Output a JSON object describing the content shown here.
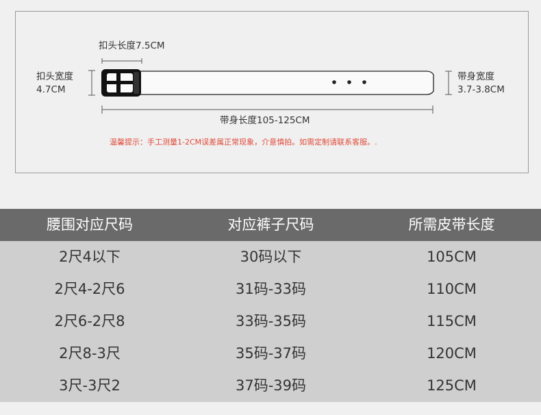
{
  "diagram": {
    "buckle_length_label": "扣头长度7.5CM",
    "buckle_width_title": "扣头宽度",
    "buckle_width_value": "4.7CM",
    "strap_width_title": "带身宽度",
    "strap_width_value": "3.7-3.8CM",
    "strap_length_label": "带身长度105-125CM",
    "note": "温馨提示：手工测量1-2CM误差属正常现象，介意慎拍。如需定制请联系客服。."
  },
  "table": {
    "headers": [
      "腰围对应尺码",
      "对应裤子尺码",
      "所需皮带长度"
    ],
    "rows": [
      [
        "2尺4以下",
        "30码以下",
        "105CM"
      ],
      [
        "2尺4-2尺6",
        "31码-33码",
        "110CM"
      ],
      [
        "2尺6-2尺8",
        "33码-35码",
        "115CM"
      ],
      [
        "2尺8-3尺",
        "35码-37码",
        "120CM"
      ],
      [
        "3尺-3尺2",
        "37码-39码",
        "125CM"
      ]
    ]
  }
}
